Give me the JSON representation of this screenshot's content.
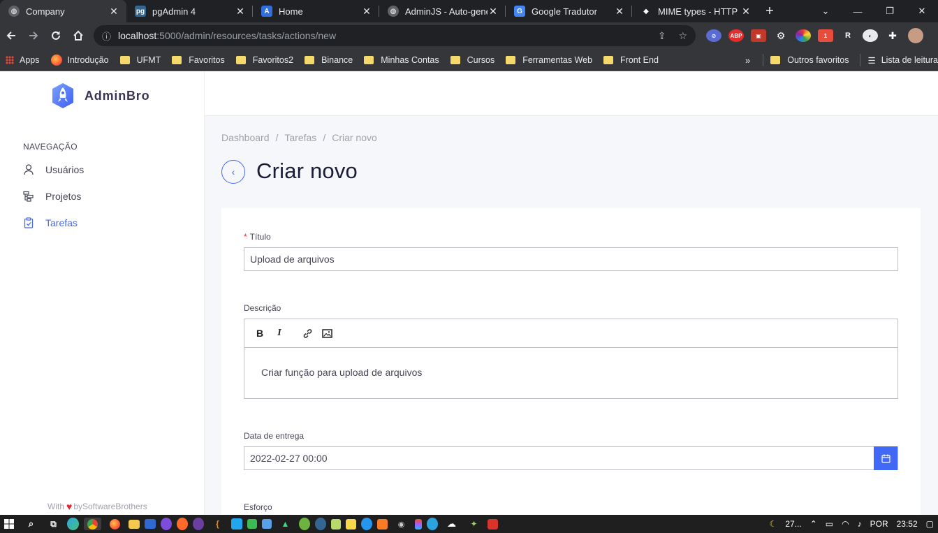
{
  "browser": {
    "tabs": [
      {
        "title": "Company",
        "close": "✕",
        "active": true
      },
      {
        "title": "pgAdmin 4",
        "close": "✕"
      },
      {
        "title": "Home",
        "close": "✕"
      },
      {
        "title": "AdminJS - Auto-gener",
        "close": "✕"
      },
      {
        "title": "Google Tradutor",
        "close": "✕"
      },
      {
        "title": "MIME types - HTTP | M",
        "close": "✕"
      }
    ],
    "new_tab": "+",
    "url_host": "localhost",
    "url_path": ":5000/admin/resources/tasks/actions/new",
    "bookmarks": {
      "apps": "Apps",
      "items": [
        "Introdução",
        "UFMT",
        "Favoritos",
        "Favoritos2",
        "Binance",
        "Minhas Contas",
        "Cursos",
        "Ferramentas Web",
        "Front End"
      ],
      "overflow": "»",
      "other": "Outros favoritos",
      "reading_list": "Lista de leitura"
    }
  },
  "app": {
    "brand": "AdminBro",
    "nav_heading": "NAVEGAÇÃO",
    "nav_items": [
      {
        "label": "Usuários",
        "icon": "user-icon"
      },
      {
        "label": "Projetos",
        "icon": "tree-icon"
      },
      {
        "label": "Tarefas",
        "icon": "clipboard-icon",
        "active": true
      }
    ],
    "footer_with": "With",
    "footer_by": "bySoftwareBrothers",
    "breadcrumb": [
      "Dashboard",
      "Tarefas",
      "Criar novo"
    ],
    "page_title": "Criar novo",
    "form": {
      "titulo_label": "Título",
      "titulo_required_mark": "*",
      "titulo_value": "Upload de arquivos",
      "descricao_label": "Descrição",
      "descricao_value": "Criar função para upload de arquivos",
      "data_label": "Data de entrega",
      "data_value": "2022-02-27 00:00",
      "esforco_label": "Esforço"
    },
    "accent_color": "#4268f6"
  },
  "taskbar": {
    "weather": "27...",
    "language": "POR",
    "time": "23:52"
  }
}
